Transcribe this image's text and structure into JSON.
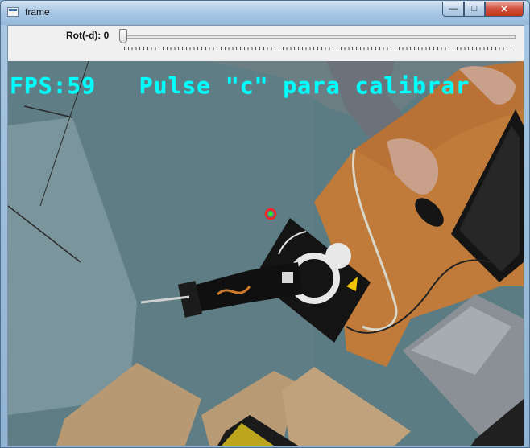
{
  "window": {
    "title": "frame",
    "controls": {
      "minimize": "—",
      "maximize": "□",
      "close": "✕"
    }
  },
  "trackbar": {
    "label": "Rot(-d): 0",
    "value": 0
  },
  "overlay": {
    "fps": "FPS:59",
    "message": "Pulse \"c\" para calibrar"
  },
  "colors": {
    "overlay_text": "#00ffff",
    "marker_ring": "#ff2020",
    "marker_center": "#20ff20"
  },
  "camera": {
    "scene": "video-feed",
    "marker": "target-marker"
  }
}
